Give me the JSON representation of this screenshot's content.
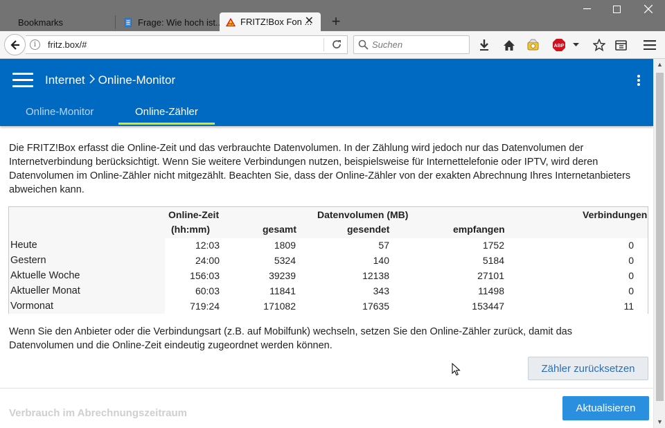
{
  "browser": {
    "tabs": [
      {
        "label": "Bookmarks"
      },
      {
        "label": "Frage: Wie hoch ist..."
      },
      {
        "label": "FRITZ!Box Fon ..."
      }
    ],
    "url": "fritz.box/#",
    "search_placeholder": "Suchen",
    "addon_badge": "ABP"
  },
  "header": {
    "breadcrumb_section": "Internet",
    "breadcrumb_page": "Online-Monitor",
    "tabs": [
      {
        "label": "Online-Monitor",
        "active": false
      },
      {
        "label": "Online-Zähler",
        "active": true
      }
    ],
    "accent_color": "#0069c2",
    "active_underline_color": "#e1e800"
  },
  "intro_text": "Die FRITZ!Box erfasst die Online-Zeit und das verbrauchte Datenvolumen. In der Zählung wird jedoch nur das Datenvolumen der Internetverbindung berücksichtigt. Wenn Sie weitere Verbindungen nutzen, beispielsweise für Internettelefonie oder IPTV, wird deren Datenvolumen im Online-Zähler nicht mitgezählt. Beachten Sie, dass der Online-Zähler von der exakten Abrechnung Ihres Internetanbieters abweichen kann.",
  "table": {
    "headers": {
      "online_time": "Online-Zeit",
      "online_time_unit": "(hh:mm)",
      "data_volume": "Datenvolumen (MB)",
      "total": "gesamt",
      "sent": "gesendet",
      "received": "empfangen",
      "connections": "Verbindungen"
    },
    "rows": [
      {
        "label": "Heute",
        "time": "12:03",
        "total": "1809",
        "sent": "57",
        "received": "1752",
        "connections": "0"
      },
      {
        "label": "Gestern",
        "time": "24:00",
        "total": "5324",
        "sent": "140",
        "received": "5184",
        "connections": "0"
      },
      {
        "label": "Aktuelle Woche",
        "time": "156:03",
        "total": "39239",
        "sent": "12138",
        "received": "27101",
        "connections": "0"
      },
      {
        "label": "Aktueller Monat",
        "time": "60:03",
        "total": "11841",
        "sent": "343",
        "received": "11498",
        "connections": "0"
      },
      {
        "label": "Vormonat",
        "time": "719:24",
        "total": "171082",
        "sent": "17635",
        "received": "153447",
        "connections": "11"
      }
    ]
  },
  "note_text": "Wenn Sie den Anbieter oder die Verbindungsart (z.B. auf Mobilfunk) wechseln, setzen Sie den Online-Zähler zurück, damit das Datenvolumen und die Online-Zeit eindeutig zugeordnet werden können.",
  "reset_button": "Zähler zurücksetzen",
  "next_section_title": "Verbrauch im Abrechnungszeitraum",
  "refresh_button": "Aktualisieren"
}
